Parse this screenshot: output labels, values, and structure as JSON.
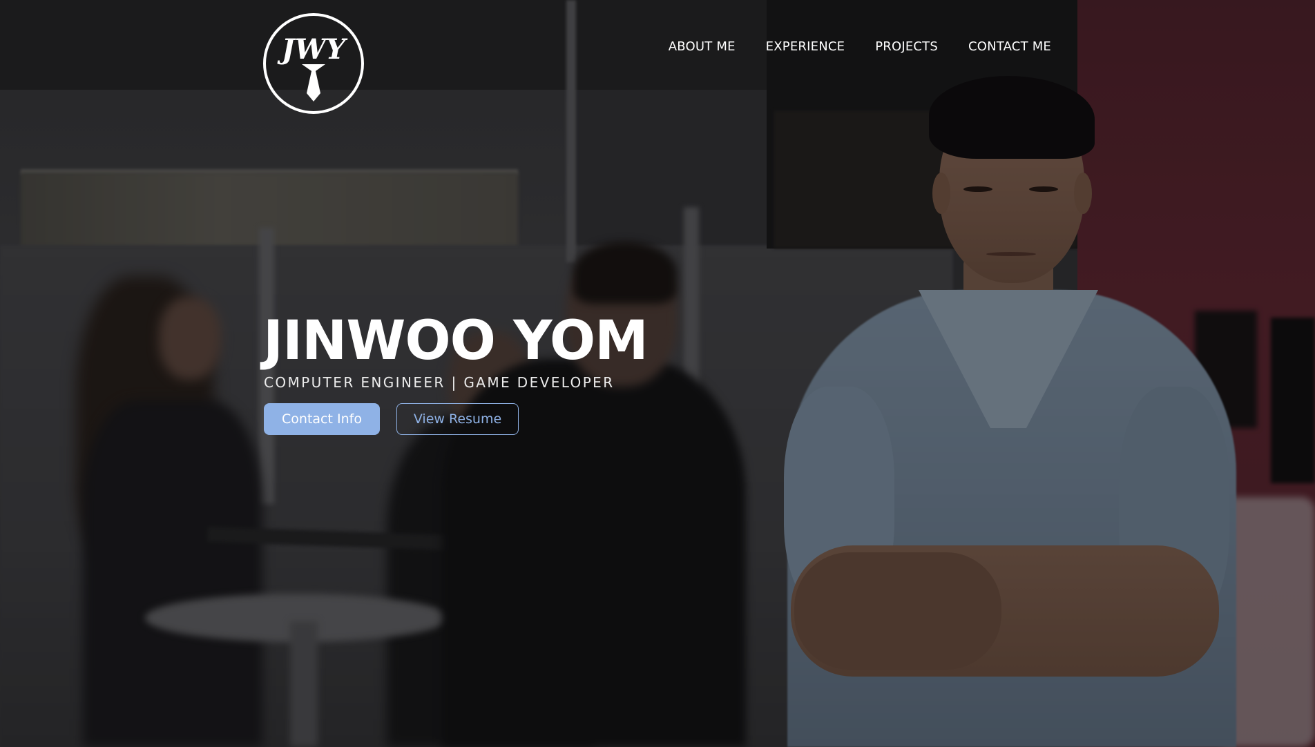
{
  "logo": {
    "monogram": "JWY",
    "icon": "tie-monogram-logo"
  },
  "nav": {
    "items": [
      {
        "label": "ABOUT ME"
      },
      {
        "label": "EXPERIENCE"
      },
      {
        "label": "PROJECTS"
      },
      {
        "label": "CONTACT ME"
      }
    ]
  },
  "hero": {
    "name": "JINWOO YOM",
    "subtitle": "COMPUTER ENGINEER | GAME DEVELOPER",
    "contact_button": "Contact Info",
    "resume_button": "View Resume",
    "background_image": "photo of a man in a light blue shirt with arms crossed in an office, colleagues in background"
  },
  "colors": {
    "accent": "#8fb2e6",
    "text": "#ffffff",
    "overlay": "rgba(0,0,0,0.38)"
  }
}
